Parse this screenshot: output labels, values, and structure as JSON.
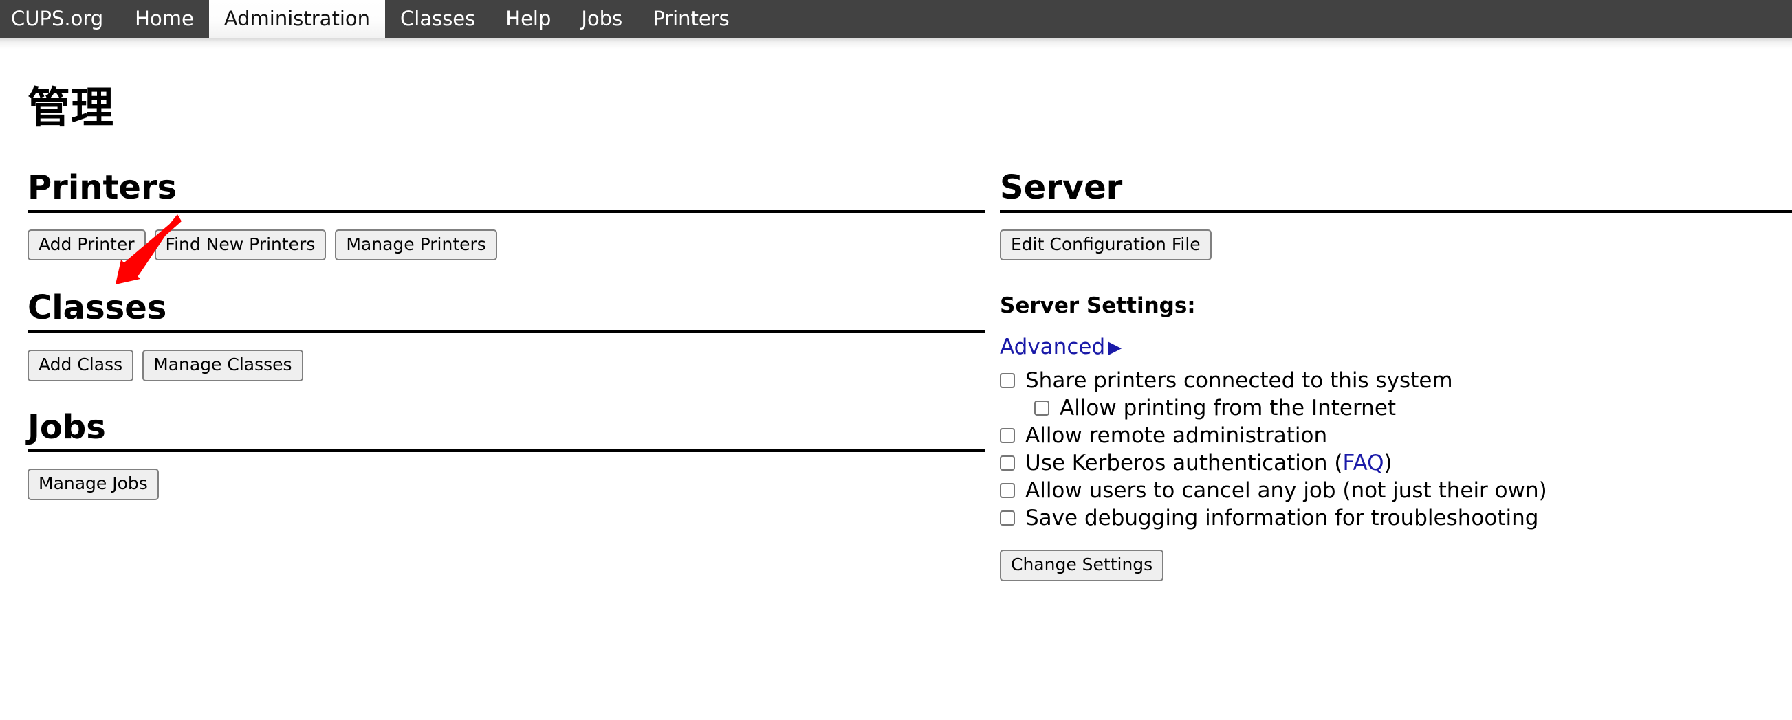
{
  "navbar": {
    "items": [
      {
        "label": "CUPS.org",
        "active": false
      },
      {
        "label": "Home",
        "active": false
      },
      {
        "label": "Administration",
        "active": true
      },
      {
        "label": "Classes",
        "active": false
      },
      {
        "label": "Help",
        "active": false
      },
      {
        "label": "Jobs",
        "active": false
      },
      {
        "label": "Printers",
        "active": false
      }
    ]
  },
  "page": {
    "title": "管理"
  },
  "sections": {
    "printers": {
      "heading": "Printers",
      "buttons": [
        {
          "label": "Add Printer"
        },
        {
          "label": "Find New Printers"
        },
        {
          "label": "Manage Printers"
        }
      ]
    },
    "classes": {
      "heading": "Classes",
      "buttons": [
        {
          "label": "Add Class"
        },
        {
          "label": "Manage Classes"
        }
      ]
    },
    "jobs": {
      "heading": "Jobs",
      "buttons": [
        {
          "label": "Manage Jobs"
        }
      ]
    },
    "server": {
      "heading": "Server",
      "edit_config_label": "Edit Configuration File",
      "settings_label": "Server Settings:",
      "advanced_label": "Advanced",
      "advanced_triangle": "▶",
      "checkboxes": [
        {
          "label": "Share printers connected to this system",
          "checked": false,
          "indented": false
        },
        {
          "label": "Allow printing from the Internet",
          "checked": false,
          "indented": true
        },
        {
          "label": "Allow remote administration",
          "checked": false,
          "indented": false
        },
        {
          "label_before": "Use Kerberos authentication (",
          "link": "FAQ",
          "label_after": ")",
          "checked": false,
          "indented": false
        },
        {
          "label": "Allow users to cancel any job (not just their own)",
          "checked": false,
          "indented": false
        },
        {
          "label": "Save debugging information for troubleshooting",
          "checked": false,
          "indented": false
        }
      ],
      "change_settings_label": "Change Settings"
    }
  },
  "annotation": {
    "arrow_color": "#FF0000",
    "points_at": "Add Printer"
  },
  "colors": {
    "navbar_bg": "#424242",
    "navbar_text": "#ffffff",
    "active_tab_bg": "#ffffff",
    "link": "#1a1aa8",
    "button_bg": "#efefef",
    "button_border": "#808080",
    "rule": "#000000",
    "annotation": "#FF0000"
  }
}
